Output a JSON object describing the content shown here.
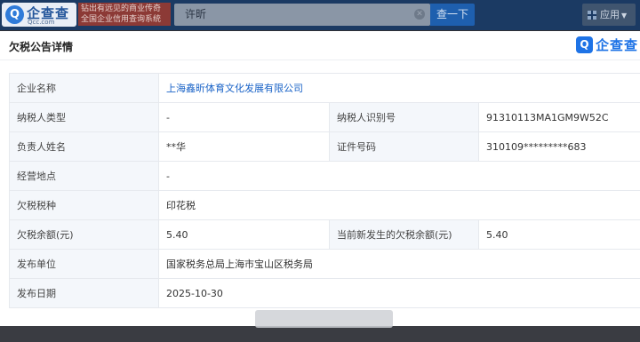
{
  "topbar": {
    "logo_text": "企查查",
    "logo_sub": "Qcc.com",
    "slogan": "钻出有远见的商业传奇 全国企业信用查询系统",
    "search_value": "许昕",
    "search_button": "查一下",
    "apps_label": "应用"
  },
  "modal": {
    "title": "欠税公告详情",
    "brand_text": "企查查",
    "rows": [
      {
        "label": "企业名称",
        "value": "上海鑫昕体育文化发展有限公司"
      },
      {
        "label": "纳税人类型",
        "value": "-",
        "label2": "纳税人识别号",
        "value2": "91310113MA1GM9W52C"
      },
      {
        "label": "负责人姓名",
        "value": "**华",
        "label2": "证件号码",
        "value2": "310109*********683"
      },
      {
        "label": "经营地点",
        "value": "-"
      },
      {
        "label": "欠税税种",
        "value": "印花税"
      },
      {
        "label": "欠税余额(元)",
        "value": "5.40",
        "label2": "当前新发生的欠税余额(元)",
        "value2": "5.40"
      },
      {
        "label": "发布单位",
        "value": "国家税务总局上海市宝山区税务局"
      },
      {
        "label": "发布日期",
        "value": "2025-10-30"
      }
    ]
  }
}
